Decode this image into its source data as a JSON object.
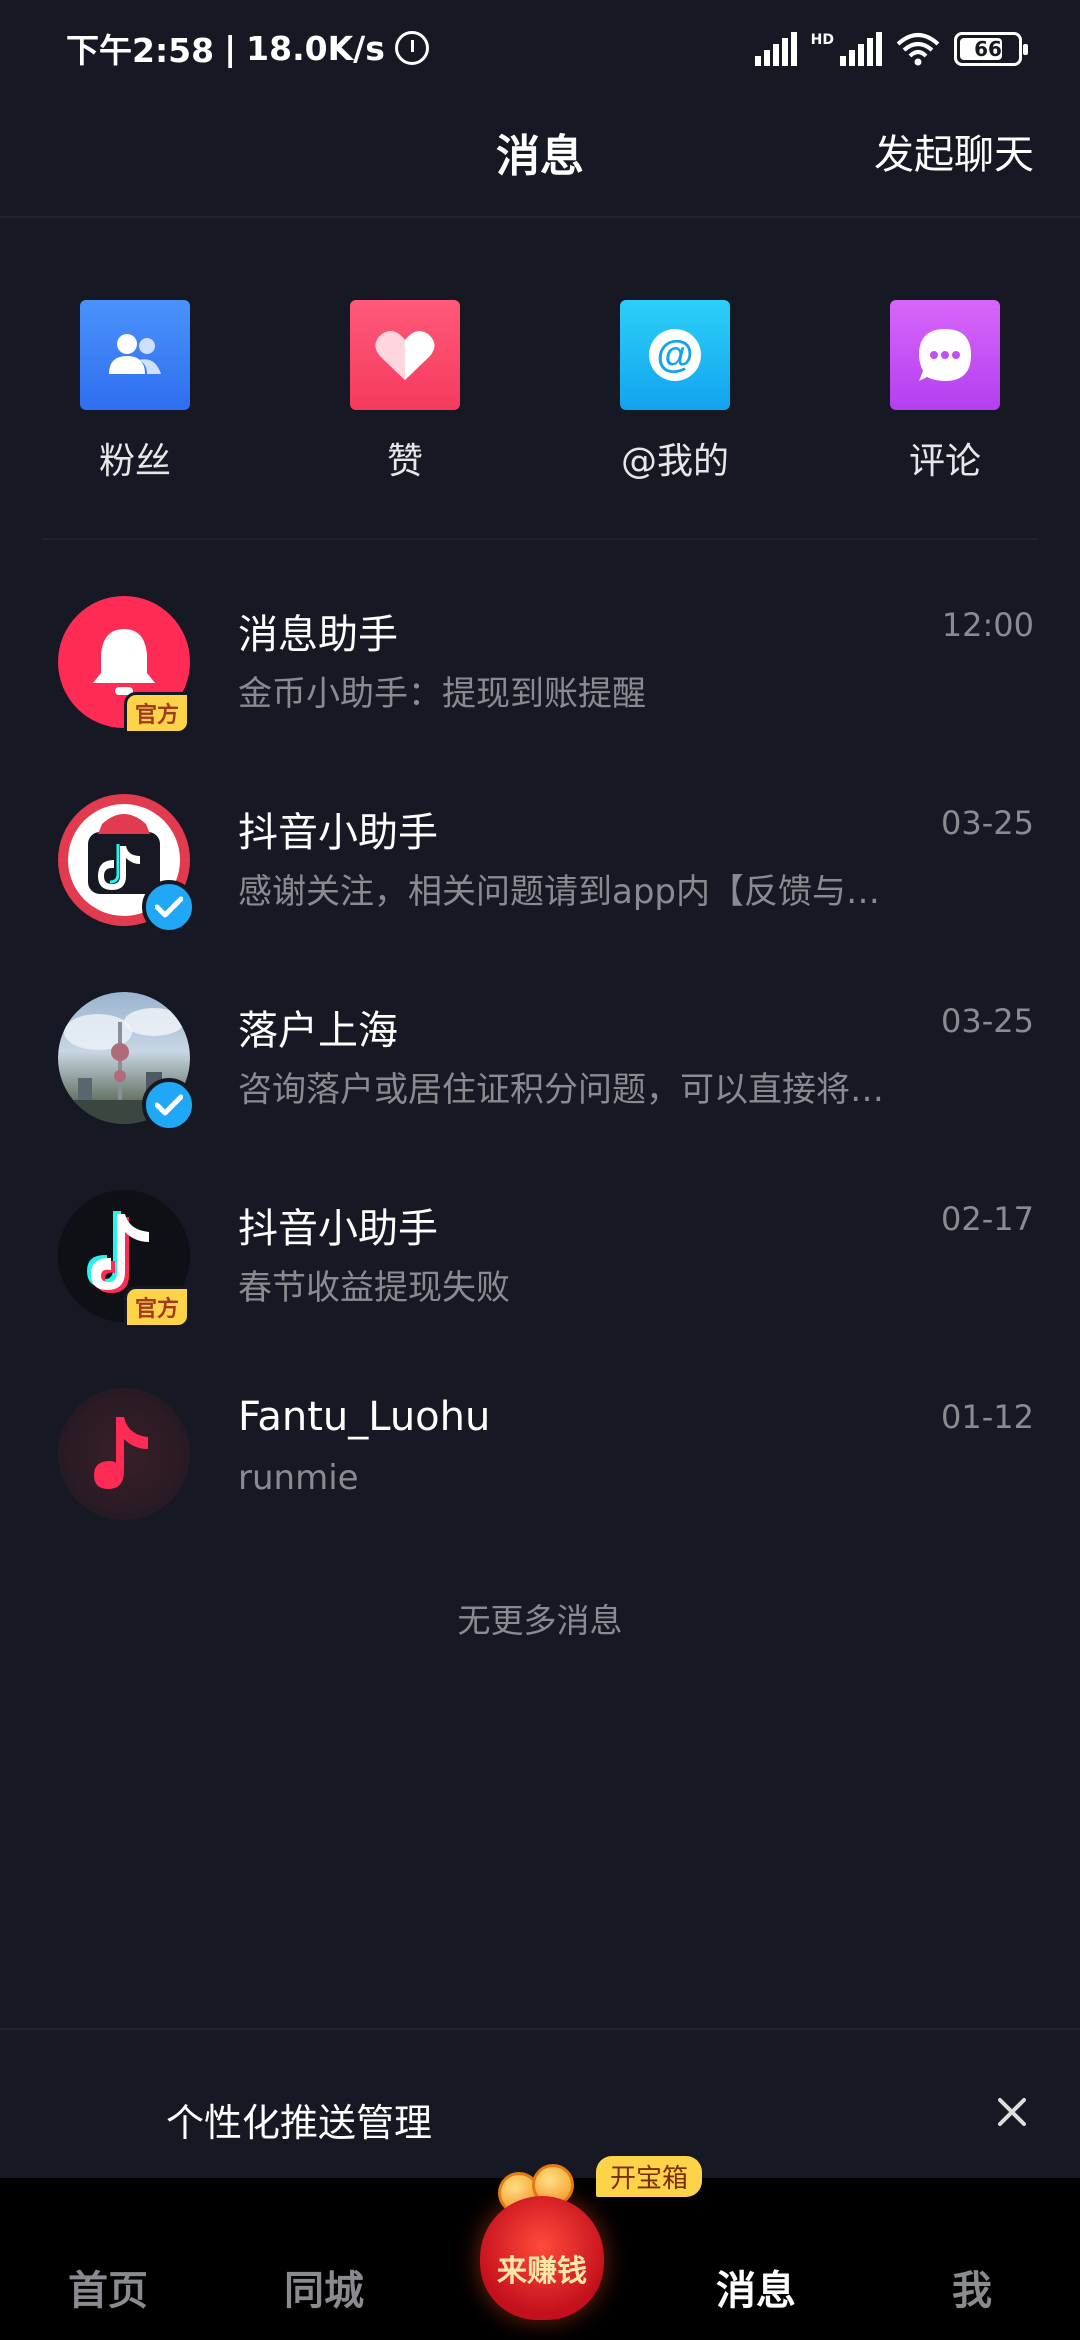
{
  "status_bar": {
    "time": "下午2:58",
    "speed": "18.0K/s",
    "network": "HD",
    "battery": "66"
  },
  "header": {
    "title": "消息",
    "action": "发起聊天"
  },
  "quick_entries": [
    {
      "label": "粉丝",
      "icon": "fans-icon",
      "color": "#3d82f4"
    },
    {
      "label": "赞",
      "icon": "heart-icon",
      "color": "#fe2c55"
    },
    {
      "label": "@我的",
      "icon": "at-icon",
      "color": "#14b4f0"
    },
    {
      "label": "评论",
      "icon": "comment-icon",
      "color": "#c44ef0"
    }
  ],
  "messages": [
    {
      "name": "消息助手",
      "preview": "金币小助手：提现到账提醒",
      "time": "12:00",
      "badge": "官方"
    },
    {
      "name": "抖音小助手",
      "preview": "感谢关注，相关问题请到app内【反馈与…",
      "time": "03-25",
      "badge": "verified"
    },
    {
      "name": "落户上海",
      "preview": "咨询落户或居住证积分问题，可以直接将…",
      "time": "03-25",
      "badge": "verified"
    },
    {
      "name": "抖音小助手",
      "preview": "春节收益提现失败",
      "time": "02-17",
      "badge": "官方"
    },
    {
      "name": "Fantu_Luohu",
      "preview": "runmie",
      "time": "01-12",
      "badge": ""
    }
  ],
  "no_more_text": "无更多消息",
  "push_bar": {
    "label": "个性化推送管理"
  },
  "bottom_nav": {
    "items": [
      "首页",
      "同城",
      "消息",
      "我"
    ],
    "earn_label": "来赚钱",
    "chest_tag": "开宝箱",
    "active": "消息"
  }
}
